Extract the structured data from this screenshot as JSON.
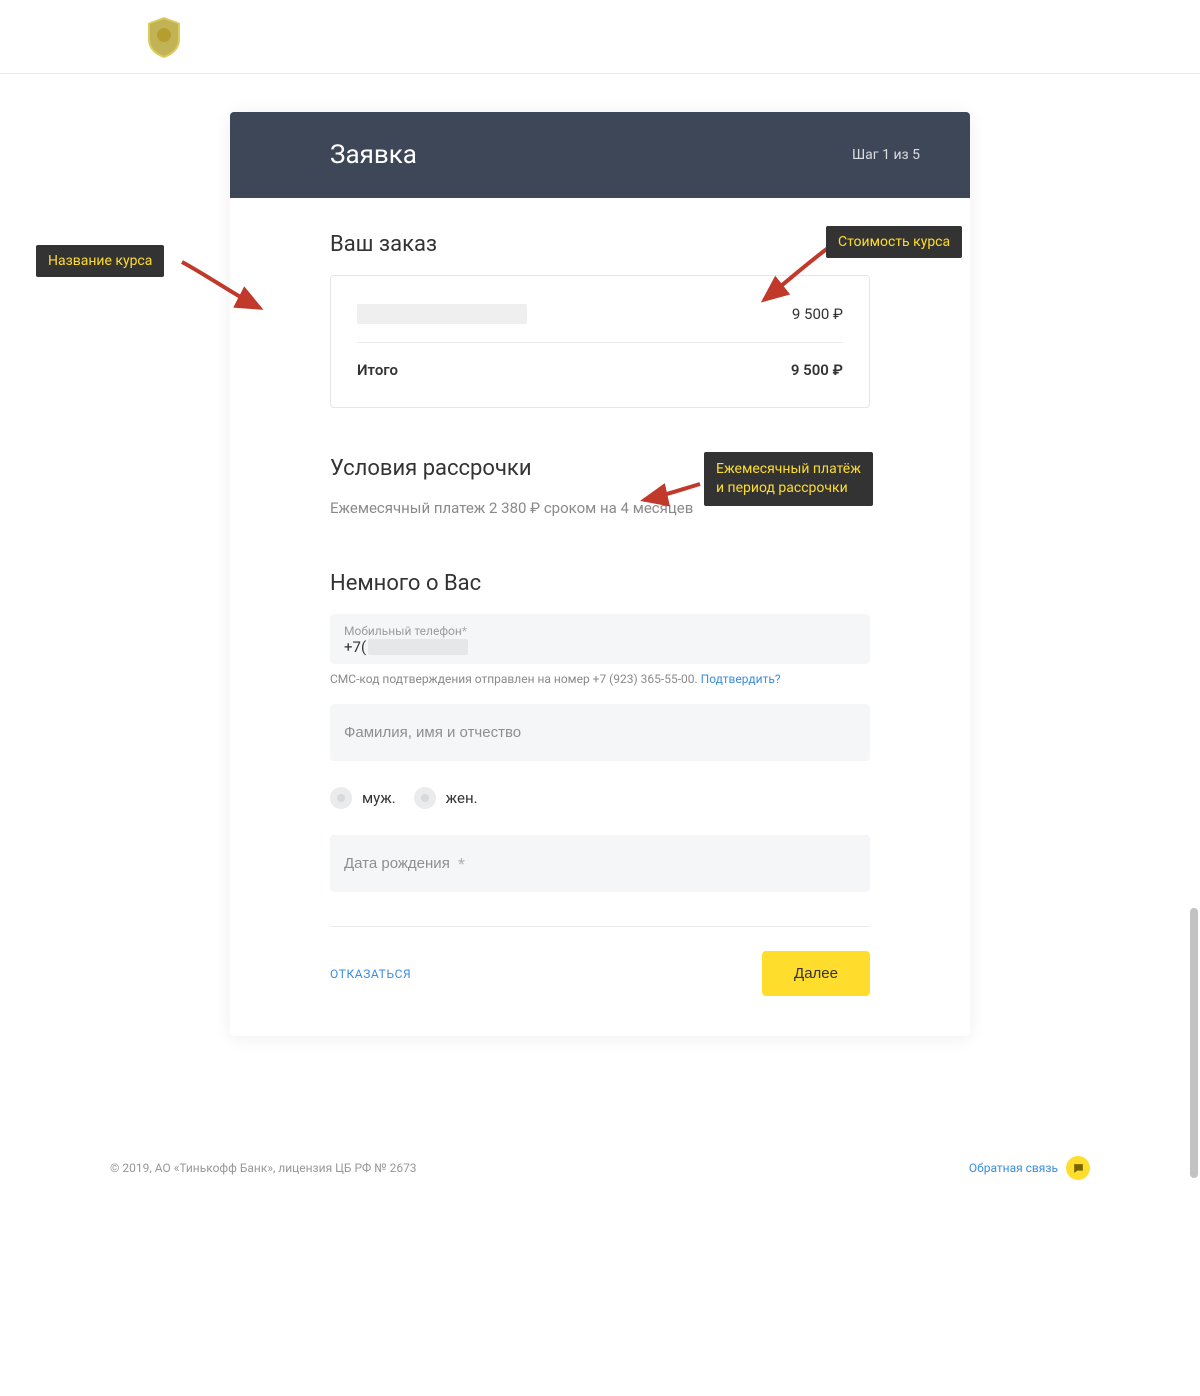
{
  "header": {
    "title": "Заявка",
    "step": "Шаг 1 из 5"
  },
  "order": {
    "section_title": "Ваш заказ",
    "item_price": "9 500 ₽",
    "total_label": "Итого",
    "total_price": "9 500 ₽"
  },
  "installment": {
    "section_title": "Условия рассрочки",
    "text": "Ежемесячный платеж 2 380 ₽ сроком на 4 месяцев"
  },
  "about": {
    "section_title": "Немного о Вас",
    "phone_label": "Мобильный телефон",
    "phone_prefix": "+7(",
    "sms_note": "СМС-код подтверждения отправлен на номер +7 (923) 365-55-00. ",
    "confirm_link": "Подтвердить?",
    "fio_placeholder": "Фамилия, имя и отчество",
    "gender_male": "муж.",
    "gender_female": "жен.",
    "dob_placeholder": "Дата рождения"
  },
  "actions": {
    "decline": "ОТКАЗАТЬСЯ",
    "next": "Далее"
  },
  "annotations": {
    "course_name": "Название курса",
    "course_price": "Стоимость курса",
    "monthly": "Ежемесячный платёж\nи период рассрочки"
  },
  "footer": {
    "copyright": "© 2019, АО «Тинькофф Банк», лицензия ЦБ РФ № 2673",
    "feedback": "Обратная связь"
  }
}
